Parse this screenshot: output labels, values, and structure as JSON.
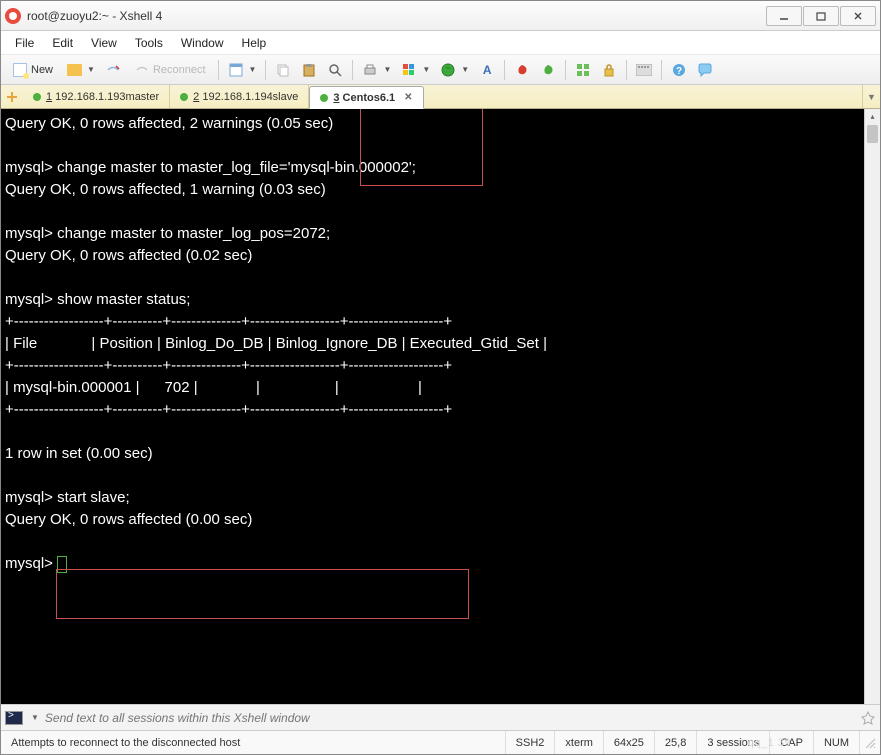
{
  "window": {
    "title": "root@zuoyu2:~ - Xshell 4"
  },
  "menu": [
    "File",
    "Edit",
    "View",
    "Tools",
    "Window",
    "Help"
  ],
  "toolbar": {
    "new_label": "New",
    "reconnect_label": "Reconnect"
  },
  "tabs": [
    {
      "num": "1",
      "rest": " 192.168.1.193master",
      "active": false,
      "led": "green"
    },
    {
      "num": "2",
      "rest": " 192.168.1.194slave",
      "active": false,
      "led": "green"
    },
    {
      "num": "3",
      "rest": " Centos6.1",
      "active": true,
      "led": "green"
    }
  ],
  "terminal": {
    "lines": [
      "Query OK, 0 rows affected, 2 warnings (0.05 sec)",
      "",
      "mysql> change master to master_log_file='mysql-bin.000002';",
      "Query OK, 0 rows affected, 1 warning (0.03 sec)",
      "",
      "mysql> change master to master_log_pos=2072;",
      "Query OK, 0 rows affected (0.02 sec)",
      "",
      "mysql> show master status;",
      "+------------------+----------+--------------+------------------+-------------------+",
      "| File             | Position | Binlog_Do_DB | Binlog_Ignore_DB | Executed_Gtid_Set |",
      "+------------------+----------+--------------+------------------+-------------------+",
      "| mysql-bin.000001 |      702 |              |                  |                   |",
      "+------------------+----------+--------------+------------------+-------------------+",
      "1 row in set (0.00 sec)",
      "",
      "mysql> start slave;",
      "Query OK, 0 rows affected (0.00 sec)",
      "",
      "mysql> "
    ]
  },
  "sendbar": {
    "placeholder": "Send text to all sessions within this Xshell window"
  },
  "status": {
    "message": "Attempts to reconnect to the disconnected host",
    "proto": "SSH2",
    "term": "xterm",
    "size": "64x25",
    "pos": "25,8",
    "sessions": "3 sessions",
    "cap": "CAP",
    "num": "NUM",
    "watermark": "t qq_1      39"
  }
}
